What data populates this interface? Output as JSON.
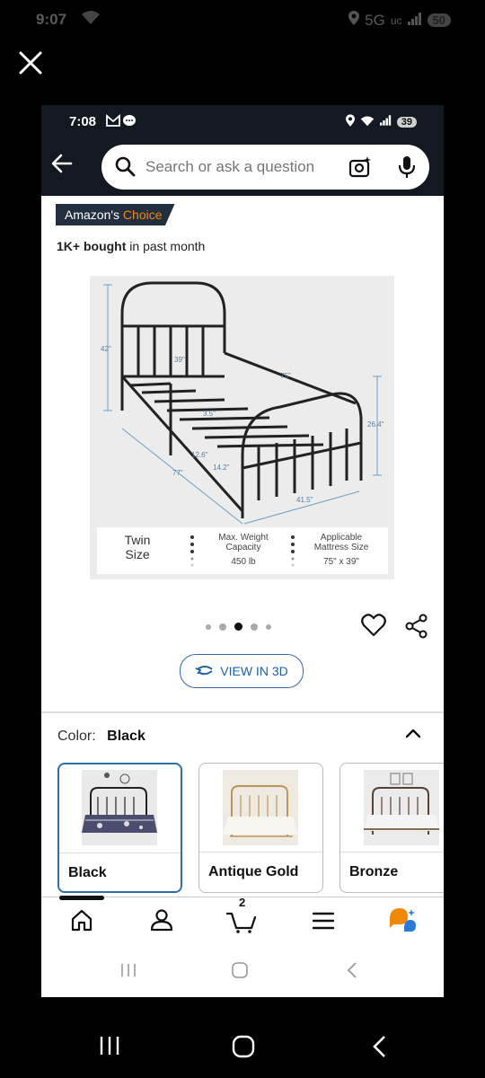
{
  "outer_status": {
    "time": "9:07",
    "network": "5G",
    "uc": "uc",
    "battery": "50"
  },
  "inner_status": {
    "time": "7:08",
    "battery": "39"
  },
  "search": {
    "placeholder": "Search or ask a question"
  },
  "product": {
    "badge_prefix": "Amazon's",
    "badge_choice": "Choice",
    "bought_bold": "1K+ bought",
    "bought_rest": "in past month",
    "dims": {
      "height": "42\"",
      "width": "39\"",
      "length": "75\"",
      "clearance": "26.4\"",
      "side": "77\"",
      "d1": "12.6\"",
      "d2": "14.2\"",
      "d3": "41.5\"",
      "d4": "3.5\""
    },
    "specs": {
      "size_line1": "Twin",
      "size_line2": "Size",
      "weight_line1": "Max. Weight",
      "weight_line2": "Capacity",
      "weight_value": "450 lb",
      "mattress_line1": "Applicable",
      "mattress_line2": "Mattress Size",
      "mattress_value": "75\" x 39\""
    }
  },
  "carousel": {
    "count": 5,
    "active_index": 2
  },
  "view3d_label": "VIEW IN 3D",
  "color": {
    "label": "Color:",
    "selected": "Black",
    "options": [
      {
        "name": "Black"
      },
      {
        "name": "Antique Gold"
      },
      {
        "name": "Bronze"
      }
    ]
  },
  "cart": {
    "count": "2"
  },
  "colors": {
    "amazon_dark": "#131921",
    "badge_bg": "#232f3e",
    "choice_orange": "#f08804",
    "link_blue": "#2162a1",
    "selected_border": "#2f6fa7"
  },
  "icons": [
    "close-icon",
    "back-arrow-icon",
    "search-icon",
    "camera-icon",
    "mic-icon",
    "heart-icon",
    "share-icon",
    "rotate-3d-icon",
    "chevron-up-icon",
    "home-icon",
    "user-icon",
    "cart-icon",
    "menu-icon",
    "rufus-icon"
  ]
}
